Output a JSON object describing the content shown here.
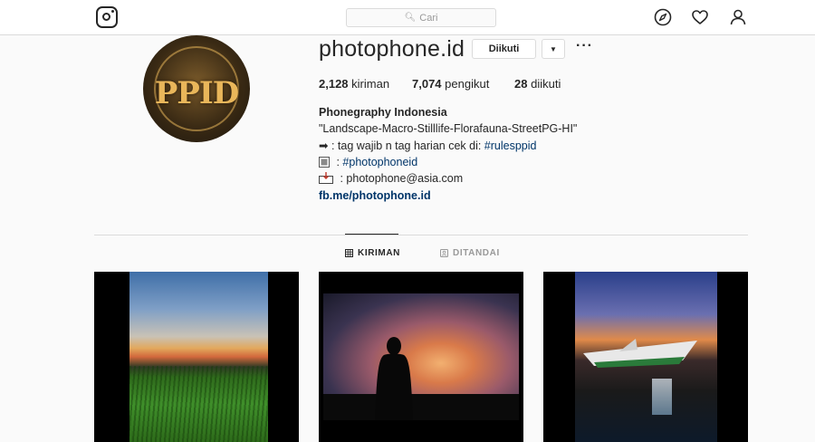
{
  "topbar": {
    "search_placeholder": "Cari",
    "icons": [
      "instagram-logo",
      "compass-icon",
      "heart-icon",
      "user-icon"
    ]
  },
  "profile": {
    "username": "photophone.id",
    "follow_label": "Diikuti",
    "stats": {
      "posts_count": "2,128",
      "posts_label": "kiriman",
      "followers_count": "7,074",
      "followers_label": "pengikut",
      "following_count": "28",
      "following_label": "diikuti"
    },
    "bio": {
      "name": "Phonegraphy Indonesia",
      "line1": "\"Landscape-Macro-Stilllife-Florafauna-StreetPG-HI\"",
      "line2_prefix": "➡ : tag wajib n tag harian cek di: ",
      "line2_tag": "#rulesppid",
      "line3_prefix": " : ",
      "line3_tag": "#photophoneid",
      "line4": " : photophone@asia.com",
      "link": "fb.me/photophone.id"
    }
  },
  "tabs": [
    {
      "label": "KIRIMAN",
      "active": true
    },
    {
      "label": "DITANDAI",
      "active": false
    }
  ],
  "colors": {
    "link": "#003569",
    "border": "#dbdbdb",
    "text": "#262626",
    "inactive_tab": "#999999"
  }
}
